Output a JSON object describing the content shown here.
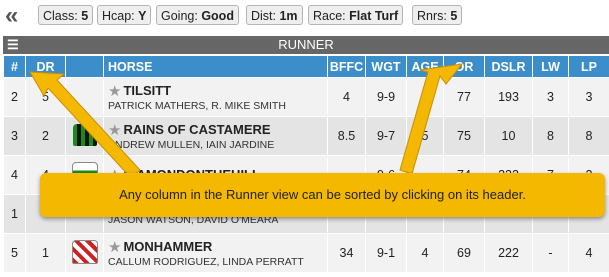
{
  "filters": {
    "back_icon": "chevron-double-left",
    "class_label": "Class:",
    "class_value": "5",
    "hcap_label": "Hcap:",
    "hcap_value": "Y",
    "going_label": "Going:",
    "going_value": "Good",
    "dist_label": "Dist:",
    "dist_value": "1m",
    "race_label": "Race:",
    "race_value": "Flat Turf",
    "rnrs_label": "Rnrs:",
    "rnrs_value": "5"
  },
  "runner_view": {
    "title": "RUNNER",
    "columns": [
      "#",
      "DR",
      "",
      "HORSE",
      "BFFC",
      "WGT",
      "AGE",
      "OR",
      "DSLR",
      "LW",
      "LP"
    ],
    "rows": [
      {
        "num": "2",
        "dr": "5",
        "name": "TILSITT",
        "people": "PATRICK MATHERS, R. MIKE SMITH",
        "bffc": "4",
        "wgt": "9-9",
        "age": "5",
        "or": "77",
        "dslr": "193",
        "lw": "3",
        "lp": "3",
        "silk": "none"
      },
      {
        "num": "3",
        "dr": "2",
        "name": "RAINS OF CASTAMERE",
        "people": "ANDREW MULLEN, IAIN JARDINE",
        "bffc": "8.5",
        "wgt": "9-7",
        "age": "5",
        "or": "75",
        "dslr": "10",
        "lw": "8",
        "lp": "8",
        "silk": "green-black"
      },
      {
        "num": "4",
        "dr": "4",
        "name": "DIAMONDONTHEHILL",
        "people": "",
        "bffc": "",
        "wgt": "9-6",
        "age": "",
        "or": "74",
        "dslr": "222",
        "lw": "7",
        "lp": "2",
        "silk": "green-white"
      },
      {
        "num": "1",
        "dr": "",
        "name": "",
        "people": "JASON WATSON, DAVID O'MEARA",
        "bffc": "",
        "wgt": "",
        "age": "",
        "or": "",
        "dslr": "",
        "lw": "",
        "lp": "",
        "silk": "none"
      },
      {
        "num": "5",
        "dr": "1",
        "name": "MONHAMMER",
        "people": "CALLUM RODRIGUEZ, LINDA PERRATT",
        "bffc": "34",
        "wgt": "9-1",
        "age": "4",
        "or": "69",
        "dslr": "222",
        "lw": "-",
        "lp": "4",
        "silk": "red-white"
      }
    ]
  },
  "tooltip": {
    "text": "Any column in the Runner view can be sorted by clicking on its header.",
    "color": "#f5b800"
  }
}
